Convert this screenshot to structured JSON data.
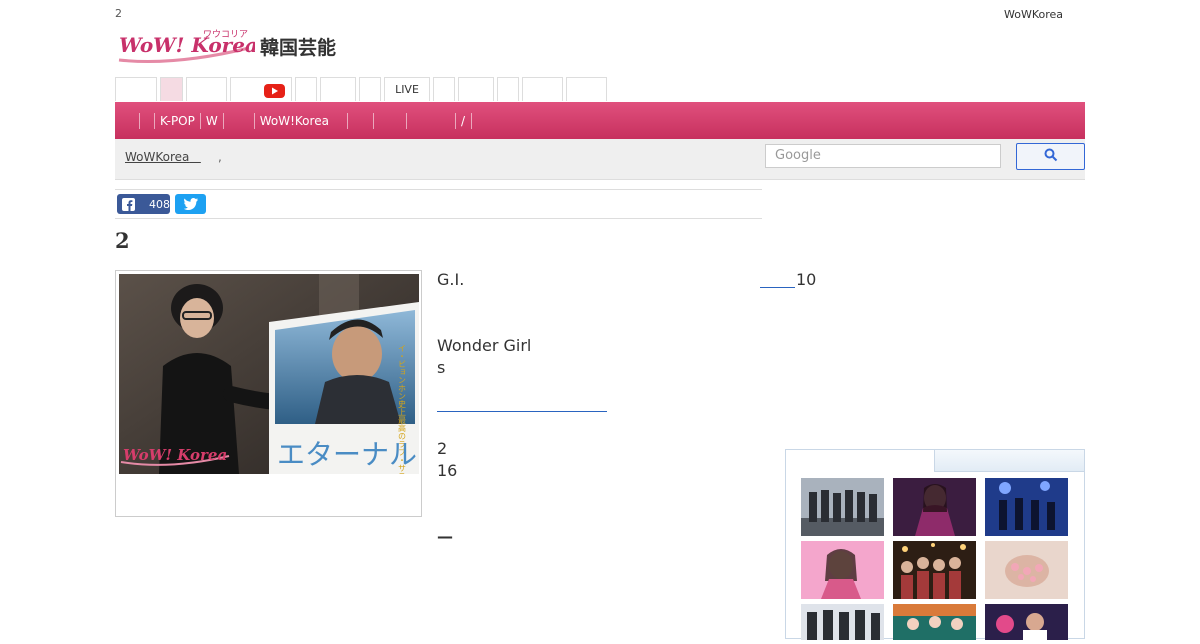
{
  "header": {
    "top_left_text": "2",
    "top_right_link": "WoWKorea",
    "logo_text": "WoW! Korea",
    "logo_kana": "ワウコリア",
    "site_subtitle": "韓国芸能"
  },
  "category_tabs": [
    {
      "label": ""
    },
    {
      "label": ""
    },
    {
      "label": ""
    },
    {
      "label": ""
    },
    {
      "label": ""
    },
    {
      "label": ""
    },
    {
      "label": ""
    },
    {
      "label": "LIVE"
    },
    {
      "label": ""
    },
    {
      "label": ""
    },
    {
      "label": ""
    },
    {
      "label": ""
    },
    {
      "label": ""
    }
  ],
  "nav": {
    "items": [
      "",
      "",
      "K-POP",
      "W",
      "",
      "WoW!Korea",
      "",
      "",
      "",
      "/"
    ]
  },
  "breadcrumb": {
    "home": "WoWKorea",
    "separator": ",",
    "current": ""
  },
  "search": {
    "placeholder": "Google"
  },
  "share": {
    "facebook_count": "408"
  },
  "article": {
    "title": "2",
    "photo_watermark": "WoW! Korea",
    "poster_title": "エターナル",
    "poster_tagline": "イ・ビョンホン史上最高のラブ・サスペンス",
    "paragraphs": {
      "p1": "G.I.",
      "p1_tail": "10",
      "p2_line1": "Wonder Girl",
      "p2_line2": "s",
      "p3_line1": "2",
      "p3_line2": "16",
      "p4": "—"
    }
  },
  "colors": {
    "brand_pink": "#d63d6b",
    "link_blue": "#2a64c0",
    "facebook_blue": "#3b5998",
    "twitter_blue": "#1da1f2",
    "youtube_red": "#e62117"
  }
}
